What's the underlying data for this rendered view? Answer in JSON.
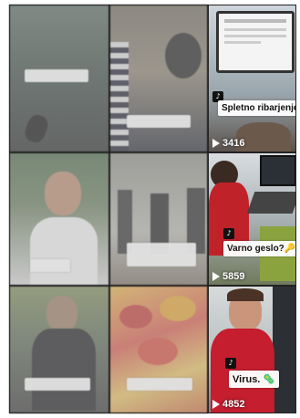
{
  "videos": [
    {
      "caption": "",
      "views": ""
    },
    {
      "caption": "",
      "views": ""
    },
    {
      "caption": "Spletno ribarjenje 🐟",
      "views": "3416"
    },
    {
      "caption": "",
      "views": ""
    },
    {
      "caption": "",
      "views": ""
    },
    {
      "caption": "Varno geslo?🔑",
      "views": "5859"
    },
    {
      "caption": "",
      "views": ""
    },
    {
      "caption": "",
      "views": ""
    },
    {
      "caption": "Virus. 🦠",
      "views": "4852"
    }
  ],
  "icons": {
    "tiktok": "tiktok-logo-icon",
    "views": "play-icon"
  },
  "colors": {
    "overlay_dim": "#b4b4b4",
    "caption_bg": "#ffffff",
    "view_text": "#ffffff"
  }
}
